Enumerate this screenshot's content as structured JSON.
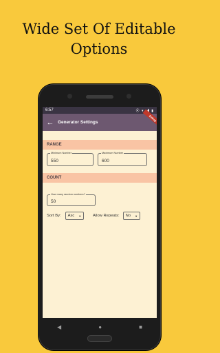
{
  "promo": {
    "line1": "Wide Set Of Editable",
    "line2": "Options"
  },
  "status": {
    "time": "6:57",
    "icons": "⦿ ▾ ◢ ▮"
  },
  "appbar": {
    "back": "←",
    "title": "Generator Settings",
    "ribbon": "Debug"
  },
  "range": {
    "header": "RANGE",
    "min_label": "Minimum Number",
    "min_value": "550",
    "max_label": "Maximum Number",
    "max_value": "600"
  },
  "count": {
    "header": "COUNT",
    "count_label": "How many random numbers?",
    "count_value": "50",
    "sort_label": "Sort By:",
    "sort_value": "Asc",
    "repeat_label": "Allow Repeats:",
    "repeat_value": "No"
  },
  "nav": {
    "back": "◀",
    "home": "●",
    "recent": "■"
  },
  "colors": {
    "background": "#f9c93c",
    "appbar": "#6d5870",
    "section": "#f9c4a4",
    "screen": "#fdf1d3"
  }
}
